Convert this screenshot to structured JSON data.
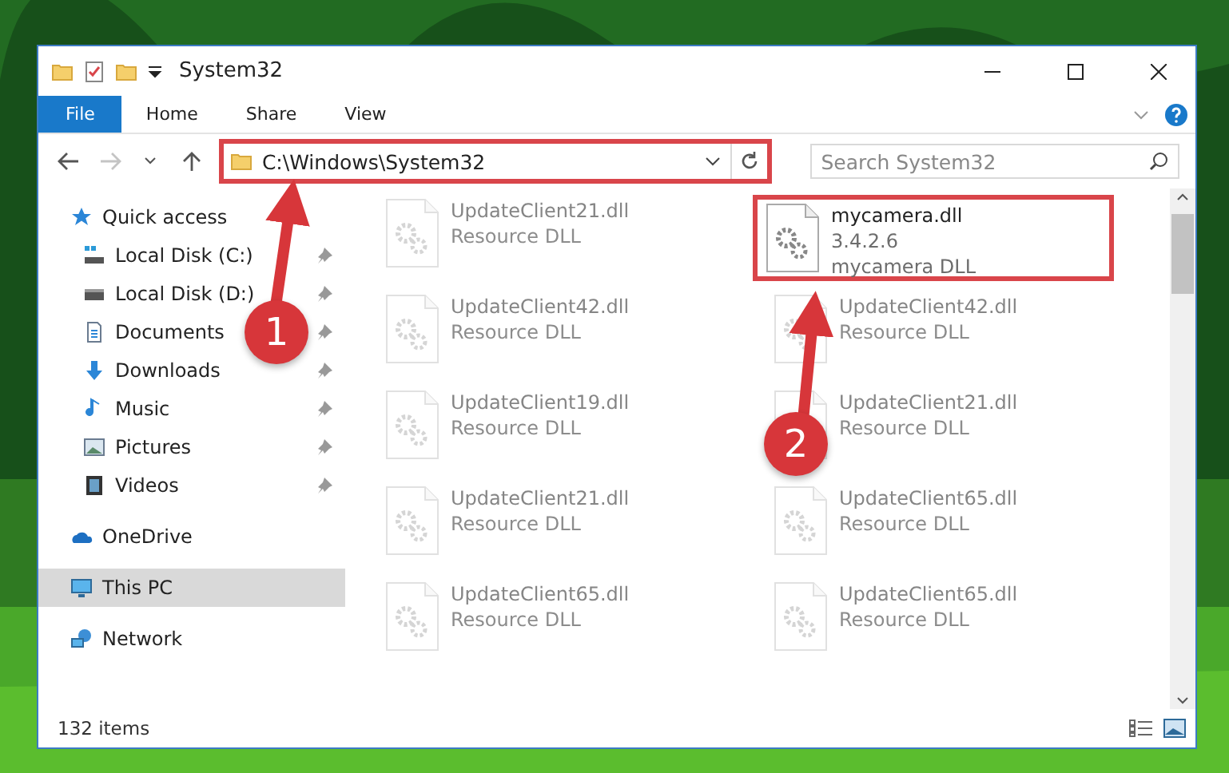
{
  "window": {
    "title": "System32"
  },
  "ribbon_tabs": [
    {
      "label": "File",
      "selected": true
    },
    {
      "label": "Home",
      "selected": false
    },
    {
      "label": "Share",
      "selected": false
    },
    {
      "label": "View",
      "selected": false
    }
  ],
  "address": {
    "path": "C:\\Windows\\System32",
    "highlighted": true
  },
  "search": {
    "placeholder": "Search System32"
  },
  "sidebar": {
    "items": [
      {
        "label": "Quick access",
        "selected": false,
        "children": [
          {
            "label": "Local Disk (C:)",
            "pinned": true,
            "selected": false
          },
          {
            "label": "Local Disk (D:)",
            "pinned": true,
            "selected": false
          },
          {
            "label": "Documents",
            "pinned": true,
            "selected": false
          },
          {
            "label": "Downloads",
            "pinned": true,
            "selected": false
          },
          {
            "label": "Music",
            "pinned": true,
            "selected": false
          },
          {
            "label": "Pictures",
            "pinned": true,
            "selected": false
          },
          {
            "label": "Videos",
            "pinned": true,
            "selected": false
          }
        ]
      },
      {
        "label": "OneDrive",
        "selected": false
      },
      {
        "label": "This PC",
        "selected": true
      },
      {
        "label": "Network",
        "selected": false
      }
    ]
  },
  "files": [
    {
      "name": "UpdateClient21.dll",
      "lines": [
        "Resource DLL"
      ],
      "blurred": true,
      "highlighted": false
    },
    {
      "name": "mycamera.dll",
      "lines": [
        "3.4.2.6",
        "mycamera DLL"
      ],
      "blurred": false,
      "highlighted": true
    },
    {
      "name": "UpdateClient42.dll",
      "lines": [
        "Resource DLL"
      ],
      "blurred": true,
      "highlighted": false
    },
    {
      "name": "UpdateClient42.dll",
      "lines": [
        "Resource DLL"
      ],
      "blurred": true,
      "highlighted": false
    },
    {
      "name": "UpdateClient19.dll",
      "lines": [
        "Resource DLL"
      ],
      "blurred": true,
      "highlighted": false
    },
    {
      "name": "UpdateClient21.dll",
      "lines": [
        "Resource DLL"
      ],
      "blurred": true,
      "highlighted": false
    },
    {
      "name": "UpdateClient21.dll",
      "lines": [
        "Resource DLL"
      ],
      "blurred": true,
      "highlighted": false
    },
    {
      "name": "UpdateClient65.dll",
      "lines": [
        "Resource DLL"
      ],
      "blurred": true,
      "highlighted": false
    },
    {
      "name": "UpdateClient65.dll",
      "lines": [
        "Resource DLL"
      ],
      "blurred": true,
      "highlighted": false
    },
    {
      "name": "UpdateClient65.dll",
      "lines": [
        "Resource DLL"
      ],
      "blurred": true,
      "highlighted": false
    }
  ],
  "status_bar": {
    "count": "132 items"
  },
  "annotations": [
    {
      "number": "1"
    },
    {
      "number": "2"
    }
  ]
}
